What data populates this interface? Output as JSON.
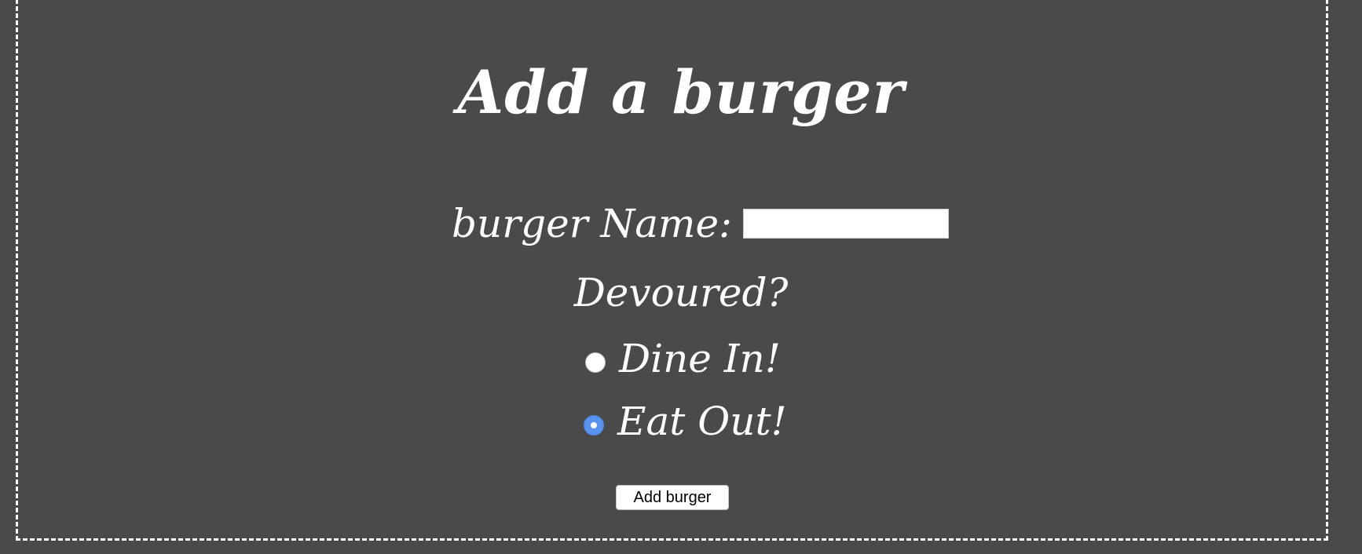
{
  "form": {
    "title": "Add a burger",
    "name_label": "burger Name:",
    "name_value": "",
    "devoured_label": "Devoured?",
    "options": [
      {
        "label": "Dine In!",
        "checked": false
      },
      {
        "label": "Eat Out!",
        "checked": true
      }
    ],
    "submit_label": "Add burger"
  },
  "colors": {
    "background": "#4a4a4a",
    "text": "#ffffff",
    "radio_checked": "#5a93ee"
  }
}
